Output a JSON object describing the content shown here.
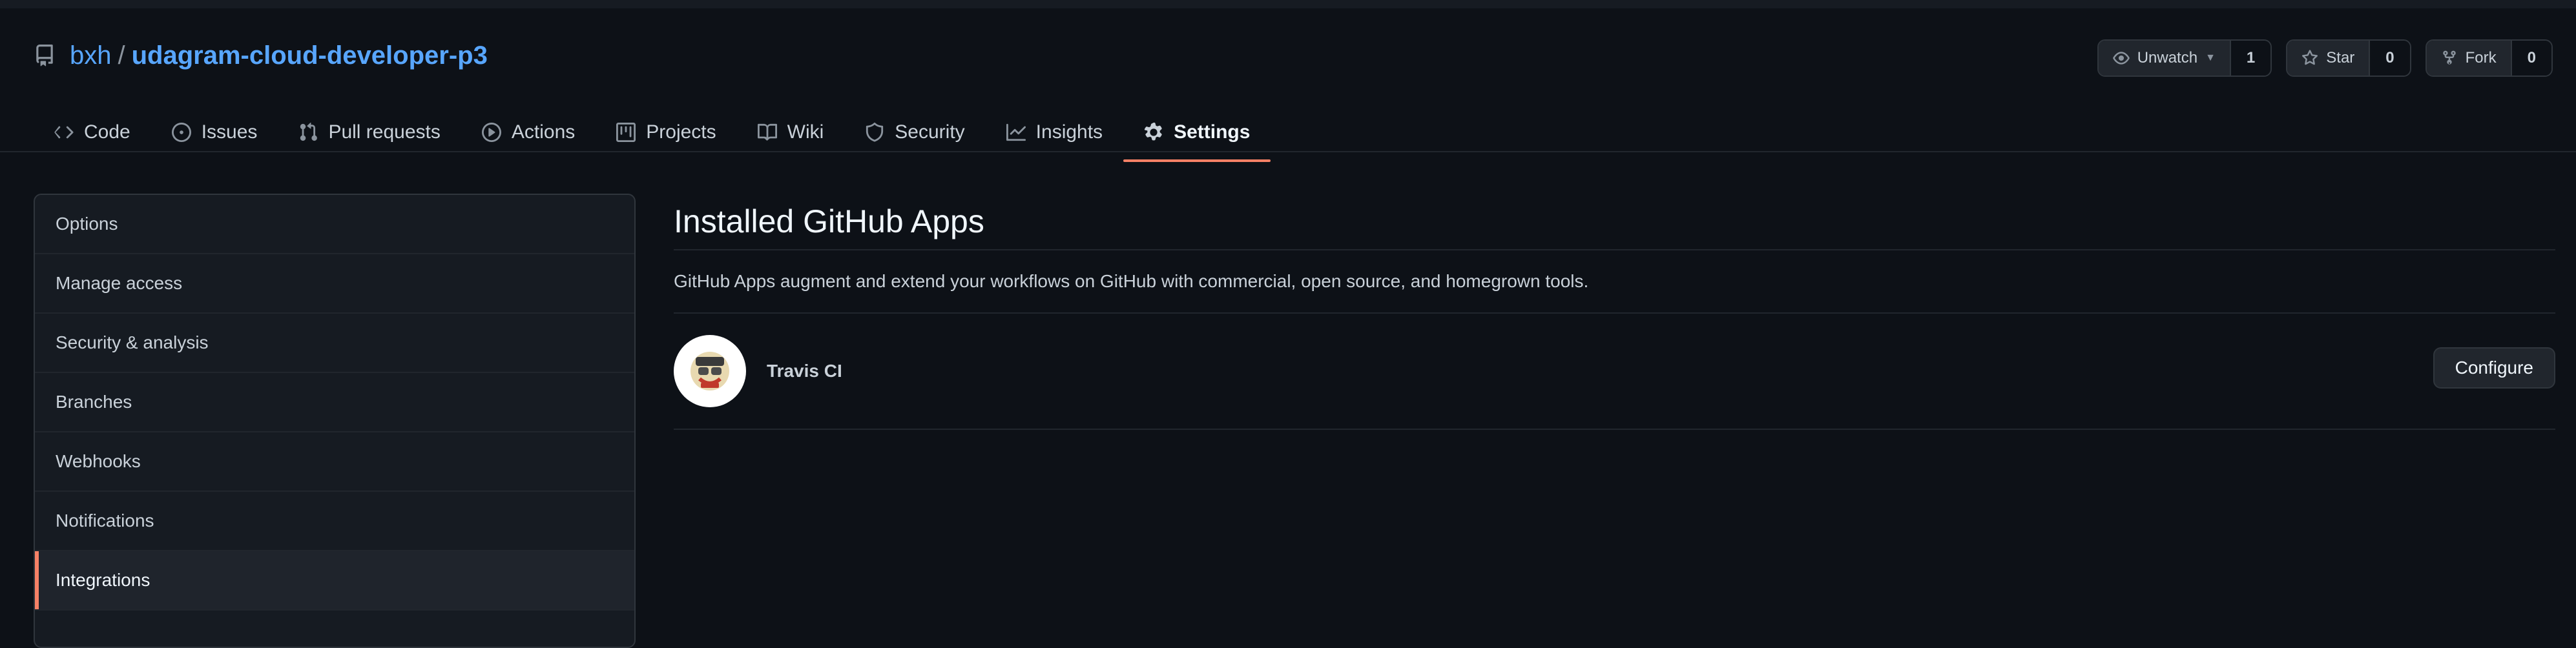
{
  "repo": {
    "owner": "bxh",
    "separator": "/",
    "name": "udagram-cloud-developer-p3"
  },
  "header_actions": [
    {
      "label": "Unwatch",
      "count": "1",
      "icon": "eye-icon"
    },
    {
      "label": "Star",
      "count": "0",
      "icon": "star-icon"
    },
    {
      "label": "Fork",
      "count": "0",
      "icon": "fork-icon"
    }
  ],
  "tabs": [
    {
      "label": "Code",
      "icon": "code-icon"
    },
    {
      "label": "Issues",
      "icon": "issue-icon"
    },
    {
      "label": "Pull requests",
      "icon": "pull-request-icon"
    },
    {
      "label": "Actions",
      "icon": "play-icon"
    },
    {
      "label": "Projects",
      "icon": "project-icon"
    },
    {
      "label": "Wiki",
      "icon": "book-icon"
    },
    {
      "label": "Security",
      "icon": "shield-icon"
    },
    {
      "label": "Insights",
      "icon": "graph-icon"
    },
    {
      "label": "Settings",
      "icon": "gear-icon",
      "selected": true
    }
  ],
  "sidebar": {
    "items": [
      {
        "label": "Options"
      },
      {
        "label": "Manage access"
      },
      {
        "label": "Security & analysis"
      },
      {
        "label": "Branches"
      },
      {
        "label": "Webhooks"
      },
      {
        "label": "Notifications"
      },
      {
        "label": "Integrations",
        "selected": true
      }
    ]
  },
  "main": {
    "title": "Installed GitHub Apps",
    "description": "GitHub Apps augment and extend your workflows on GitHub with commercial, open source, and homegrown tools.",
    "apps": [
      {
        "name": "Travis CI",
        "action": "Configure"
      }
    ]
  },
  "colors": {
    "background": "#0d1117",
    "link": "#58a6ff",
    "accent_underline": "#f78166",
    "border": "#30363d"
  }
}
